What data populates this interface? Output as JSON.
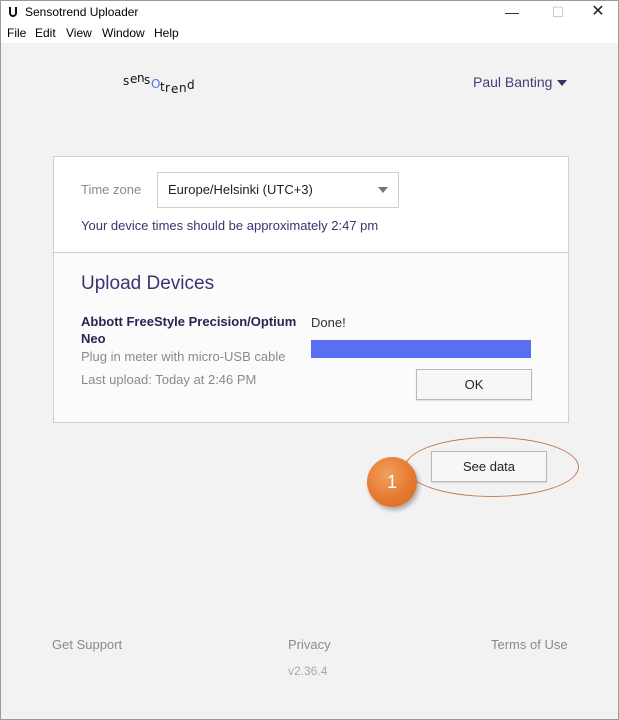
{
  "window": {
    "title": "Sensotrend Uploader",
    "minimize_glyph": "—",
    "maximize_glyph": "☐",
    "close_glyph": "✕"
  },
  "menu": [
    "File",
    "Edit",
    "View",
    "Window",
    "Help"
  ],
  "header": {
    "logo_letters": [
      "s",
      "e",
      "n",
      "s",
      "O",
      "t",
      "r",
      "e",
      "n",
      "d"
    ],
    "user_name": "Paul Banting"
  },
  "timezone": {
    "label": "Time zone",
    "selected": "Europe/Helsinki (UTC+3)",
    "hint": "Your device times should be approximately 2:47 pm"
  },
  "upload": {
    "title": "Upload Devices",
    "device_name": "Abbott FreeStyle Precision/Optium Neo",
    "device_hint": "Plug in meter with micro-USB cable",
    "last_upload": "Last upload: Today at 2:46 PM",
    "status": "Done!",
    "progress_percent": 100,
    "ok_label": "OK"
  },
  "see_data_label": "See data",
  "callout_number": "1",
  "footer": {
    "support": "Get Support",
    "privacy": "Privacy",
    "terms": "Terms of Use",
    "version": "v2.36.4"
  },
  "colors": {
    "accent": "#3f3370",
    "progress": "#5a6ef3",
    "callout": "#e67a30"
  },
  "icons": {
    "app": "u-shaped-logo-icon",
    "user_dropdown": "caret-down-icon",
    "timezone_dropdown": "caret-down-icon"
  }
}
